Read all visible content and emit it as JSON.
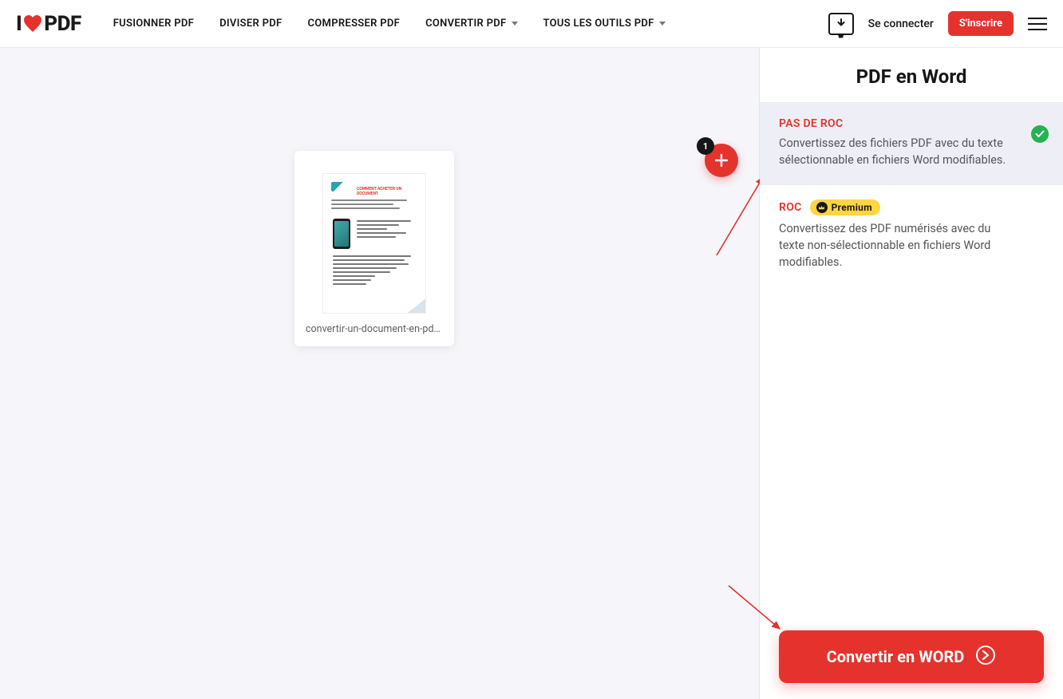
{
  "logo": {
    "prefix": "I",
    "suffix": "PDF"
  },
  "nav": {
    "merge": "FUSIONNER PDF",
    "split": "DIVISER PDF",
    "compress": "COMPRESSER PDF",
    "convert": "CONVERTIR PDF",
    "all_tools": "TOUS LES OUTILS PDF"
  },
  "header": {
    "login": "Se connecter",
    "signup": "S'inscrire"
  },
  "workspace": {
    "file_name": "convertir-un-document-en-pdf ...",
    "add_count": "1"
  },
  "sidebar": {
    "title": "PDF en Word",
    "option1": {
      "label": "PAS DE ROC",
      "desc": "Convertissez des fichiers PDF avec du texte sélectionnable en fichiers Word modifiables."
    },
    "option2": {
      "label": "ROC",
      "premium": "Premium",
      "desc": "Convertissez des PDF numérisés avec du texte non-sélectionnable en fichiers Word modifiables."
    },
    "convert_btn": "Convertir en WORD"
  },
  "colors": {
    "accent": "#e5322d",
    "success": "#24b350",
    "premium": "#ffd540"
  }
}
